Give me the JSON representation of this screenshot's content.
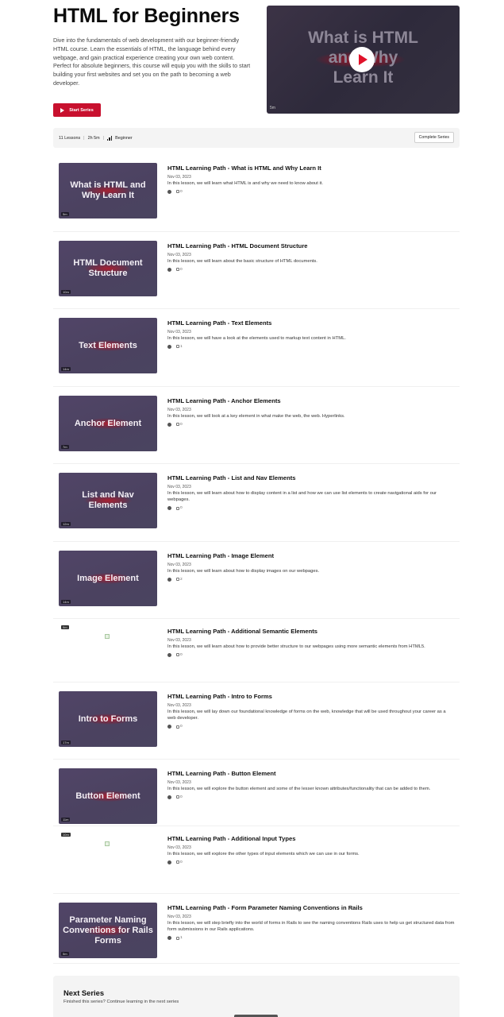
{
  "series": {
    "title": "HTML for Beginners",
    "description": "Dive into the fundamentals of web development with our beginner-friendly HTML course. Learn the essentials of HTML, the language behind every webpage, and gain practical experience creating your own web content. Perfect for absolute beginners, this course will equip you with the skills to start building your first websites and set you on the path to becoming a web developer.",
    "start_label": "Start Series",
    "video": {
      "title_line1": "What is HTML",
      "title_line2": "and Why",
      "title_line3": "Learn It",
      "duration": "5m"
    }
  },
  "meta": {
    "lessons": "11 Lessons",
    "time": "2h 5m",
    "level": "Beginner",
    "complete_label": "Complete Series"
  },
  "lessons": [
    {
      "thumb": "What is HTML and Why Learn It",
      "duration": "5m",
      "title": "HTML Learning Path - What is HTML and Why Learn It",
      "date": "Nov 03, 2023",
      "description": "In this lesson, we will learn what HTML is and why we need to know about it.",
      "comments": "0"
    },
    {
      "thumb": "HTML Document Structure",
      "duration": "10m",
      "title": "HTML Learning Path - HTML Document Structure",
      "date": "Nov 03, 2023",
      "description": "In this lesson, we will learn about the basic structure of HTML documents.",
      "comments": "0"
    },
    {
      "thumb": "Text Elements",
      "duration": "14m",
      "title": "HTML Learning Path - Text Elements",
      "date": "Nov 03, 2023",
      "description": "In this lesson, we will have a look at the elements used to markup text content in HTML.",
      "comments": "1"
    },
    {
      "thumb": "Anchor Element",
      "duration": "7m",
      "title": "HTML Learning Path - Anchor Elements",
      "date": "Nov 03, 2023",
      "description": "In this lesson, we will look at a key element in what make the web, the web. Hyperlinks.",
      "comments": "0"
    },
    {
      "thumb": "List and Nav Elements",
      "duration": "12m",
      "title": "HTML Learning Path - List and Nav Elements",
      "date": "Nov 03, 2023",
      "description": "In this lesson, we will learn about how to display content in a list and how we can use list elements to create navigational aids for our webpages.",
      "comments": "0"
    },
    {
      "thumb": "Image Element",
      "duration": "14m",
      "title": "HTML Learning Path - Image Element",
      "date": "Nov 03, 2023",
      "description": "In this lesson, we will learn about how to display images on our webpages.",
      "comments": "2"
    },
    {
      "thumb": "",
      "duration": "9m",
      "title": "HTML Learning Path - Additional Semantic Elements",
      "date": "Nov 03, 2023",
      "description": "In this lesson, we will learn about how to provide better structure to our webpages using more semantic elements from HTML5.",
      "comments": "0"
    },
    {
      "thumb": "Intro to Forms",
      "duration": "17m",
      "title": "HTML Learning Path - Intro to Forms",
      "date": "Nov 03, 2023",
      "description": "In this lesson, we will lay down our foundational knowledge of forms on the web, knowledge that will be used throughout your career as a web developer.",
      "comments": "0"
    },
    {
      "thumb": "Button Element",
      "duration": "11m",
      "title": "HTML Learning Path - Button Element",
      "date": "Nov 03, 2023",
      "description": "In this lesson, we will explore the button element and some of the lesser known attributes/functionality that can be added to them.",
      "comments": "0"
    },
    {
      "thumb": "",
      "duration": "10m",
      "title": "HTML Learning Path - Additional Input Types",
      "date": "Nov 03, 2023",
      "description": "In this lesson, we will explore the other types of input elements which we can use in our forms.",
      "comments": "0"
    },
    {
      "thumb": "Parameter Naming Conventions for Rails Forms",
      "duration": "5m",
      "title": "HTML Learning Path - Form Parameter Naming Conventions in Rails",
      "date": "Nov 03, 2023",
      "description": "In this lesson, we will step briefly into the world of forms in Rails to see the naming conventions Rails uses to help us get structured data from form submissions in our Rails applications.",
      "comments": "1"
    }
  ],
  "next": {
    "title": "Next Series",
    "subtitle": "Finished this series? Continue learning in the next series"
  },
  "colors": {
    "accent": "#c8102e",
    "thumb_bg": "#4d4463",
    "panel_bg": "#f4f4f4"
  }
}
